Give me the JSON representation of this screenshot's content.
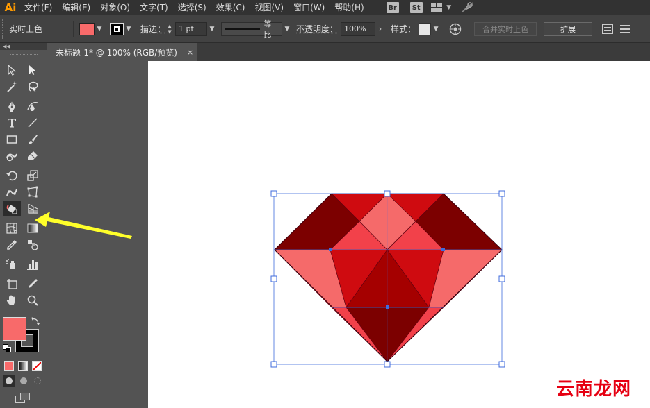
{
  "app": {
    "logo": "Ai"
  },
  "menu": {
    "items": [
      "文件(F)",
      "编辑(E)",
      "对象(O)",
      "文字(T)",
      "选择(S)",
      "效果(C)",
      "视图(V)",
      "窗口(W)",
      "帮助(H)"
    ],
    "bridge": "Br",
    "stock": "St"
  },
  "control": {
    "selection_label": "实时上色",
    "fill_color": "#f86a6a",
    "stroke_label": "描边：",
    "stroke_weight": "1 pt",
    "stroke_profile": "等比",
    "opacity_label": "不透明度：",
    "opacity_value": "100%",
    "style_label": "样式：",
    "merge_button": "合并实时上色",
    "expand_button": "扩展"
  },
  "document": {
    "tab_title": "未标题-1* @ 100% (RGB/预览)",
    "close": "×"
  },
  "toolbar": {
    "fill_color": "#f86a6a",
    "stroke_color": "#000000"
  },
  "artwork": {
    "facet_colors": {
      "dark": "#7c0000",
      "red": "#cf0b10",
      "pink": "#f56a6a",
      "mid": "#f2414a",
      "deep": "#a50000",
      "bright": "#ff1111"
    },
    "selection_color": "#3f6bdc"
  },
  "watermark": "云南龙网"
}
